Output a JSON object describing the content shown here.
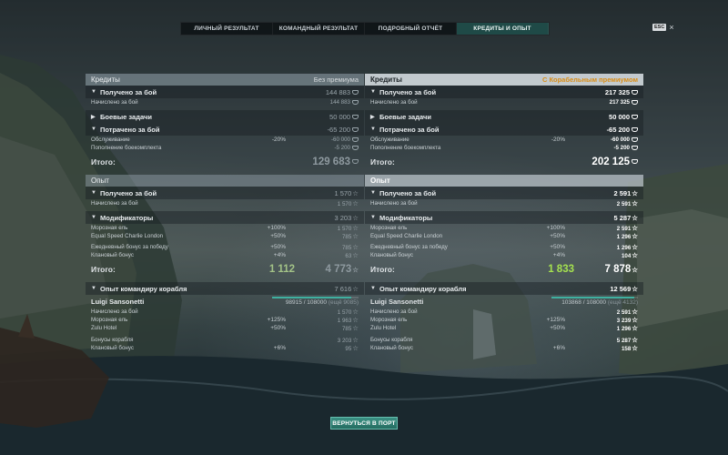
{
  "tabs": [
    "ЛИЧНЫЙ РЕЗУЛЬТАТ",
    "КОМАНДНЫЙ РЕЗУЛЬТАТ",
    "ПОДРОБНЫЙ ОТЧЁТ",
    "КРЕДИТЫ И ОПЫТ"
  ],
  "active_tab": 3,
  "esc": "ESC",
  "left": {
    "credits_title": "Кредиты",
    "credits_mode": "Без премиума",
    "received": "Получено за бой",
    "received_val": "144 883",
    "accrued": "Начислено за бой",
    "accrued_val": "144 883",
    "tasks": "Боевые задачи",
    "tasks_val": "50 000",
    "spent": "Потрачено за бой",
    "spent_val": "-65 200",
    "service": "Обслуживание",
    "service_pct": "-20%",
    "service_val": "-60 000",
    "ammo": "Пополнение боекомплекта",
    "ammo_val": "-5 200",
    "total_label": "Итого:",
    "total_val": "129 683",
    "exp_title": "Опыт",
    "exp_received": "Получено за бой",
    "exp_received_val": "1 570",
    "exp_accrued": "Начислено за бой",
    "exp_accrued_val": "1 570",
    "modifiers": "Модификаторы",
    "modifiers_val": "3 203",
    "m1": "Морозная ель",
    "m1_pct": "+100%",
    "m1_val": "1 570",
    "m2": "Equal Speed Charlie London",
    "m2_pct": "+50%",
    "m2_val": "785",
    "m3": "Ежедневный бонус за победу",
    "m3_pct": "+50%",
    "m3_val": "785",
    "m4": "Клановый бонус",
    "m4_pct": "+4%",
    "m4_val": "63",
    "exp_total_label": "Итого:",
    "exp_total_free": "1 112",
    "exp_total_val": "4 773",
    "cmdr": "Опыт командиру корабля",
    "cmdr_val": "7 616",
    "captain_name": "Luigi Sansonetti",
    "captain_progress": "98915",
    "captain_max": " / 108000 ",
    "captain_left": "(ещё 9085)",
    "captain_fraction": 0.916,
    "c1": "Начислено за бой",
    "c1_val": "1 570",
    "c2": "Морозная ель",
    "c2_pct": "+125%",
    "c2_val": "1 963",
    "c3": "Zulu Hotel",
    "c3_pct": "+50%",
    "c3_val": "785",
    "c4": "Бонусы корабля",
    "c4_val": "3 203",
    "c5": "Клановый бонус",
    "c5_pct": "+6%",
    "c5_val": "95"
  },
  "right": {
    "credits_title": "Кредиты",
    "credits_mode": "С Корабельным премиумом",
    "received": "Получено за бой",
    "received_val": "217 325",
    "accrued": "Начислено за бой",
    "accrued_val": "217 325",
    "tasks": "Боевые задачи",
    "tasks_val": "50 000",
    "spent": "Потрачено за бой",
    "spent_val": "-65 200",
    "service": "Обслуживание",
    "service_pct": "-20%",
    "service_val": "-60 000",
    "ammo": "Пополнение боекомплекта",
    "ammo_val": "-5 200",
    "total_label": "Итого:",
    "total_val": "202 125",
    "exp_title": "Опыт",
    "exp_received": "Получено за бой",
    "exp_received_val": "2 591",
    "exp_accrued": "Начислено за бой",
    "exp_accrued_val": "2 591",
    "modifiers": "Модификаторы",
    "modifiers_val": "5 287",
    "m1": "Морозная ель",
    "m1_pct": "+100%",
    "m1_val": "2 591",
    "m2": "Equal Speed Charlie London",
    "m2_pct": "+50%",
    "m2_val": "1 296",
    "m3": "Ежедневный бонус за победу",
    "m3_pct": "+50%",
    "m3_val": "1 296",
    "m4": "Клановый бонус",
    "m4_pct": "+4%",
    "m4_val": "104",
    "exp_total_label": "Итого:",
    "exp_total_free": "1 833",
    "exp_total_val": "7 878",
    "cmdr": "Опыт командиру корабля",
    "cmdr_val": "12 569",
    "captain_name": "Luigi Sansonetti",
    "captain_progress": "103868",
    "captain_max": " / 108000 ",
    "captain_left": "(ещё 4132)",
    "captain_fraction": 0.962,
    "c1": "Начислено за бой",
    "c1_val": "2 591",
    "c2": "Морозная ель",
    "c2_pct": "+125%",
    "c2_val": "3 239",
    "c3": "Zulu Hotel",
    "c3_pct": "+50%",
    "c3_val": "1 296",
    "c4": "Бонусы корабля",
    "c4_val": "5 287",
    "c5": "Клановый бонус",
    "c5_pct": "+6%",
    "c5_val": "158"
  },
  "return_button": "ВЕРНУТЬСЯ В ПОРТ",
  "colors": {
    "accent": "#1f4a47",
    "premium": "#d98d16",
    "free_exp": "#a5e14f",
    "button": "#2f7f73"
  }
}
